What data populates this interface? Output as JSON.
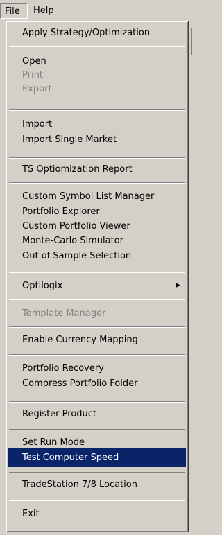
{
  "menubar": {
    "file": "File",
    "help": "Help"
  },
  "file_menu": {
    "items": [
      {
        "label": "Apply Strategy/Optimization"
      },
      {
        "label": "Open"
      },
      {
        "label": "Print"
      },
      {
        "label": "Export"
      },
      {
        "label": "Import"
      },
      {
        "label": "Import Single Market"
      },
      {
        "label": "TS Optiomization Report"
      },
      {
        "label": "Custom Symbol List Manager"
      },
      {
        "label": "Portfolio Explorer"
      },
      {
        "label": "Custom Portfolio Viewer"
      },
      {
        "label": "Monte-Carlo Simulator"
      },
      {
        "label": "Out of Sample Selection"
      },
      {
        "label": "Optilogix",
        "submenu_icon": "triangle-right-icon"
      },
      {
        "label": "Template Manager"
      },
      {
        "label": "Enable Currency Mapping"
      },
      {
        "label": "Portfolio Recovery"
      },
      {
        "label": "Compress Portfolio Folder"
      },
      {
        "label": "Register Product"
      },
      {
        "label": "Set Run Mode"
      },
      {
        "label": "Test Computer Speed"
      },
      {
        "label": "TradeStation 7/8 Location"
      },
      {
        "label": "Exit"
      }
    ]
  },
  "colors": {
    "menu_bg": "#d4d0c8",
    "highlight": "#0a246a",
    "disabled_text": "#808080"
  }
}
